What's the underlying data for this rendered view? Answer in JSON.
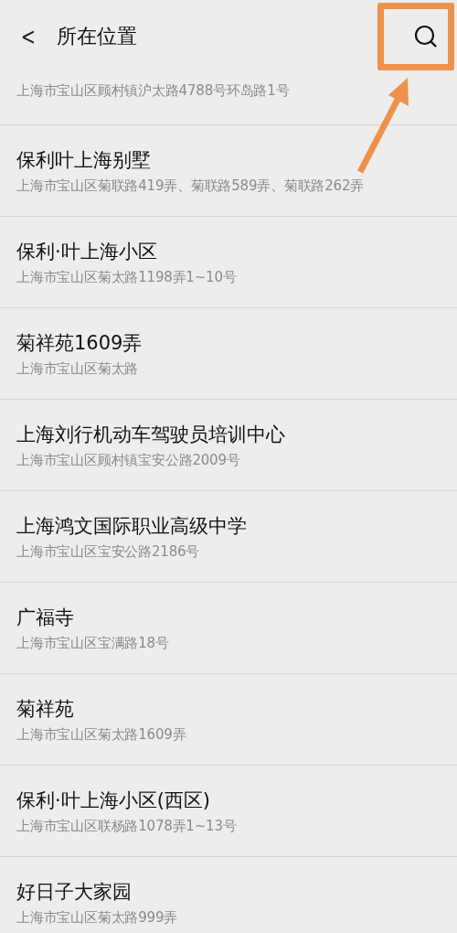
{
  "header": {
    "back": "<",
    "title": "所在位置"
  },
  "places": [
    {
      "address": "上海市宝山区顾村镇沪太路4788号环岛路1号"
    },
    {
      "name": "保利叶上海别墅",
      "address": "上海市宝山区菊联路419弄、菊联路589弄、菊联路262弄"
    },
    {
      "name": "保利·叶上海小区",
      "address": "上海市宝山区菊太路1198弄1~10号"
    },
    {
      "name": "菊祥苑1609弄",
      "address": "上海市宝山区菊太路"
    },
    {
      "name": "上海刘行机动车驾驶员培训中心",
      "address": "上海市宝山区顾村镇宝安公路2009号"
    },
    {
      "name": "上海鸿文国际职业高级中学",
      "address": "上海市宝山区宝安公路2186号"
    },
    {
      "name": "广福寺",
      "address": "上海市宝山区宝满路18号"
    },
    {
      "name": "菊祥苑",
      "address": "上海市宝山区菊太路1609弄"
    },
    {
      "name": "保利·叶上海小区(西区)",
      "address": "上海市宝山区联杨路1078弄1~13号"
    },
    {
      "name": "好日子大家园",
      "address": "上海市宝山区菊太路999弄"
    }
  ]
}
